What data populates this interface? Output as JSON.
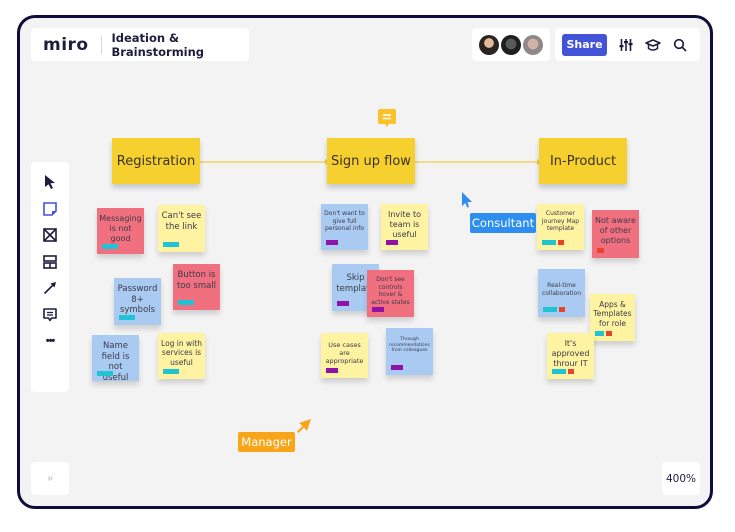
{
  "header": {
    "logo": "miro",
    "board_title": "Ideation & Brainstorming",
    "share_label": "Share",
    "avatars": [
      {
        "name": "collaborator-1",
        "color": "#c9a38a"
      },
      {
        "name": "collaborator-2",
        "color": "#3a3a3a"
      },
      {
        "name": "collaborator-3",
        "color": "#b8a8a8"
      }
    ],
    "icons": [
      "settings-sliders-icon",
      "learning-cap-icon",
      "search-icon"
    ]
  },
  "toolbar": {
    "tools": [
      "select-cursor-icon",
      "sticky-note-icon",
      "frame-icon",
      "template-icon",
      "arrow-line-icon",
      "comment-icon",
      "more-icon"
    ],
    "more_label": "•••"
  },
  "footer": {
    "expand_label": "»",
    "zoom_level": "400%"
  },
  "stages": [
    {
      "label": "Registration"
    },
    {
      "label": "Sign up flow"
    },
    {
      "label": "In-Product"
    }
  ],
  "notes": {
    "registration": [
      {
        "text": "Messaging is not good",
        "color": "pink"
      },
      {
        "text": "Can't see the link",
        "color": "yellow"
      },
      {
        "text": "Button is too small",
        "color": "pink"
      },
      {
        "text": "Password 8+ symbols",
        "color": "blue"
      },
      {
        "text": "Name field is not useful",
        "color": "blue"
      },
      {
        "text": "Log in with services is useful",
        "color": "yellow"
      }
    ],
    "signup": [
      {
        "text": "Don't want to give full personal info",
        "color": "blue"
      },
      {
        "text": "Invite to team is useful",
        "color": "yellow"
      },
      {
        "text": "Skip template",
        "color": "blue"
      },
      {
        "text": "Don't see controls hover & active states",
        "color": "pink"
      },
      {
        "text": "Use cases are appropriate",
        "color": "yellow"
      },
      {
        "text": "Through recommendations from colleagues",
        "color": "blue"
      }
    ],
    "inproduct": [
      {
        "text": "Customer Journey Map template",
        "color": "yellow"
      },
      {
        "text": "Not aware of other options",
        "color": "pink"
      },
      {
        "text": "Real-time collaboration",
        "color": "blue"
      },
      {
        "text": "Apps & Templates for role",
        "color": "yellow"
      },
      {
        "text": "It's approved throur IT",
        "color": "yellow"
      }
    ]
  },
  "tag_colors": {
    "cyan": "#1fc3d3",
    "purple": "#9012a8",
    "red": "#e8432b"
  },
  "cursors": [
    {
      "label": "Consultant",
      "color": "#2d8ef0"
    },
    {
      "label": "Manager",
      "color": "#f9a51a"
    }
  ],
  "comment_icon_color": "#f9c22a"
}
